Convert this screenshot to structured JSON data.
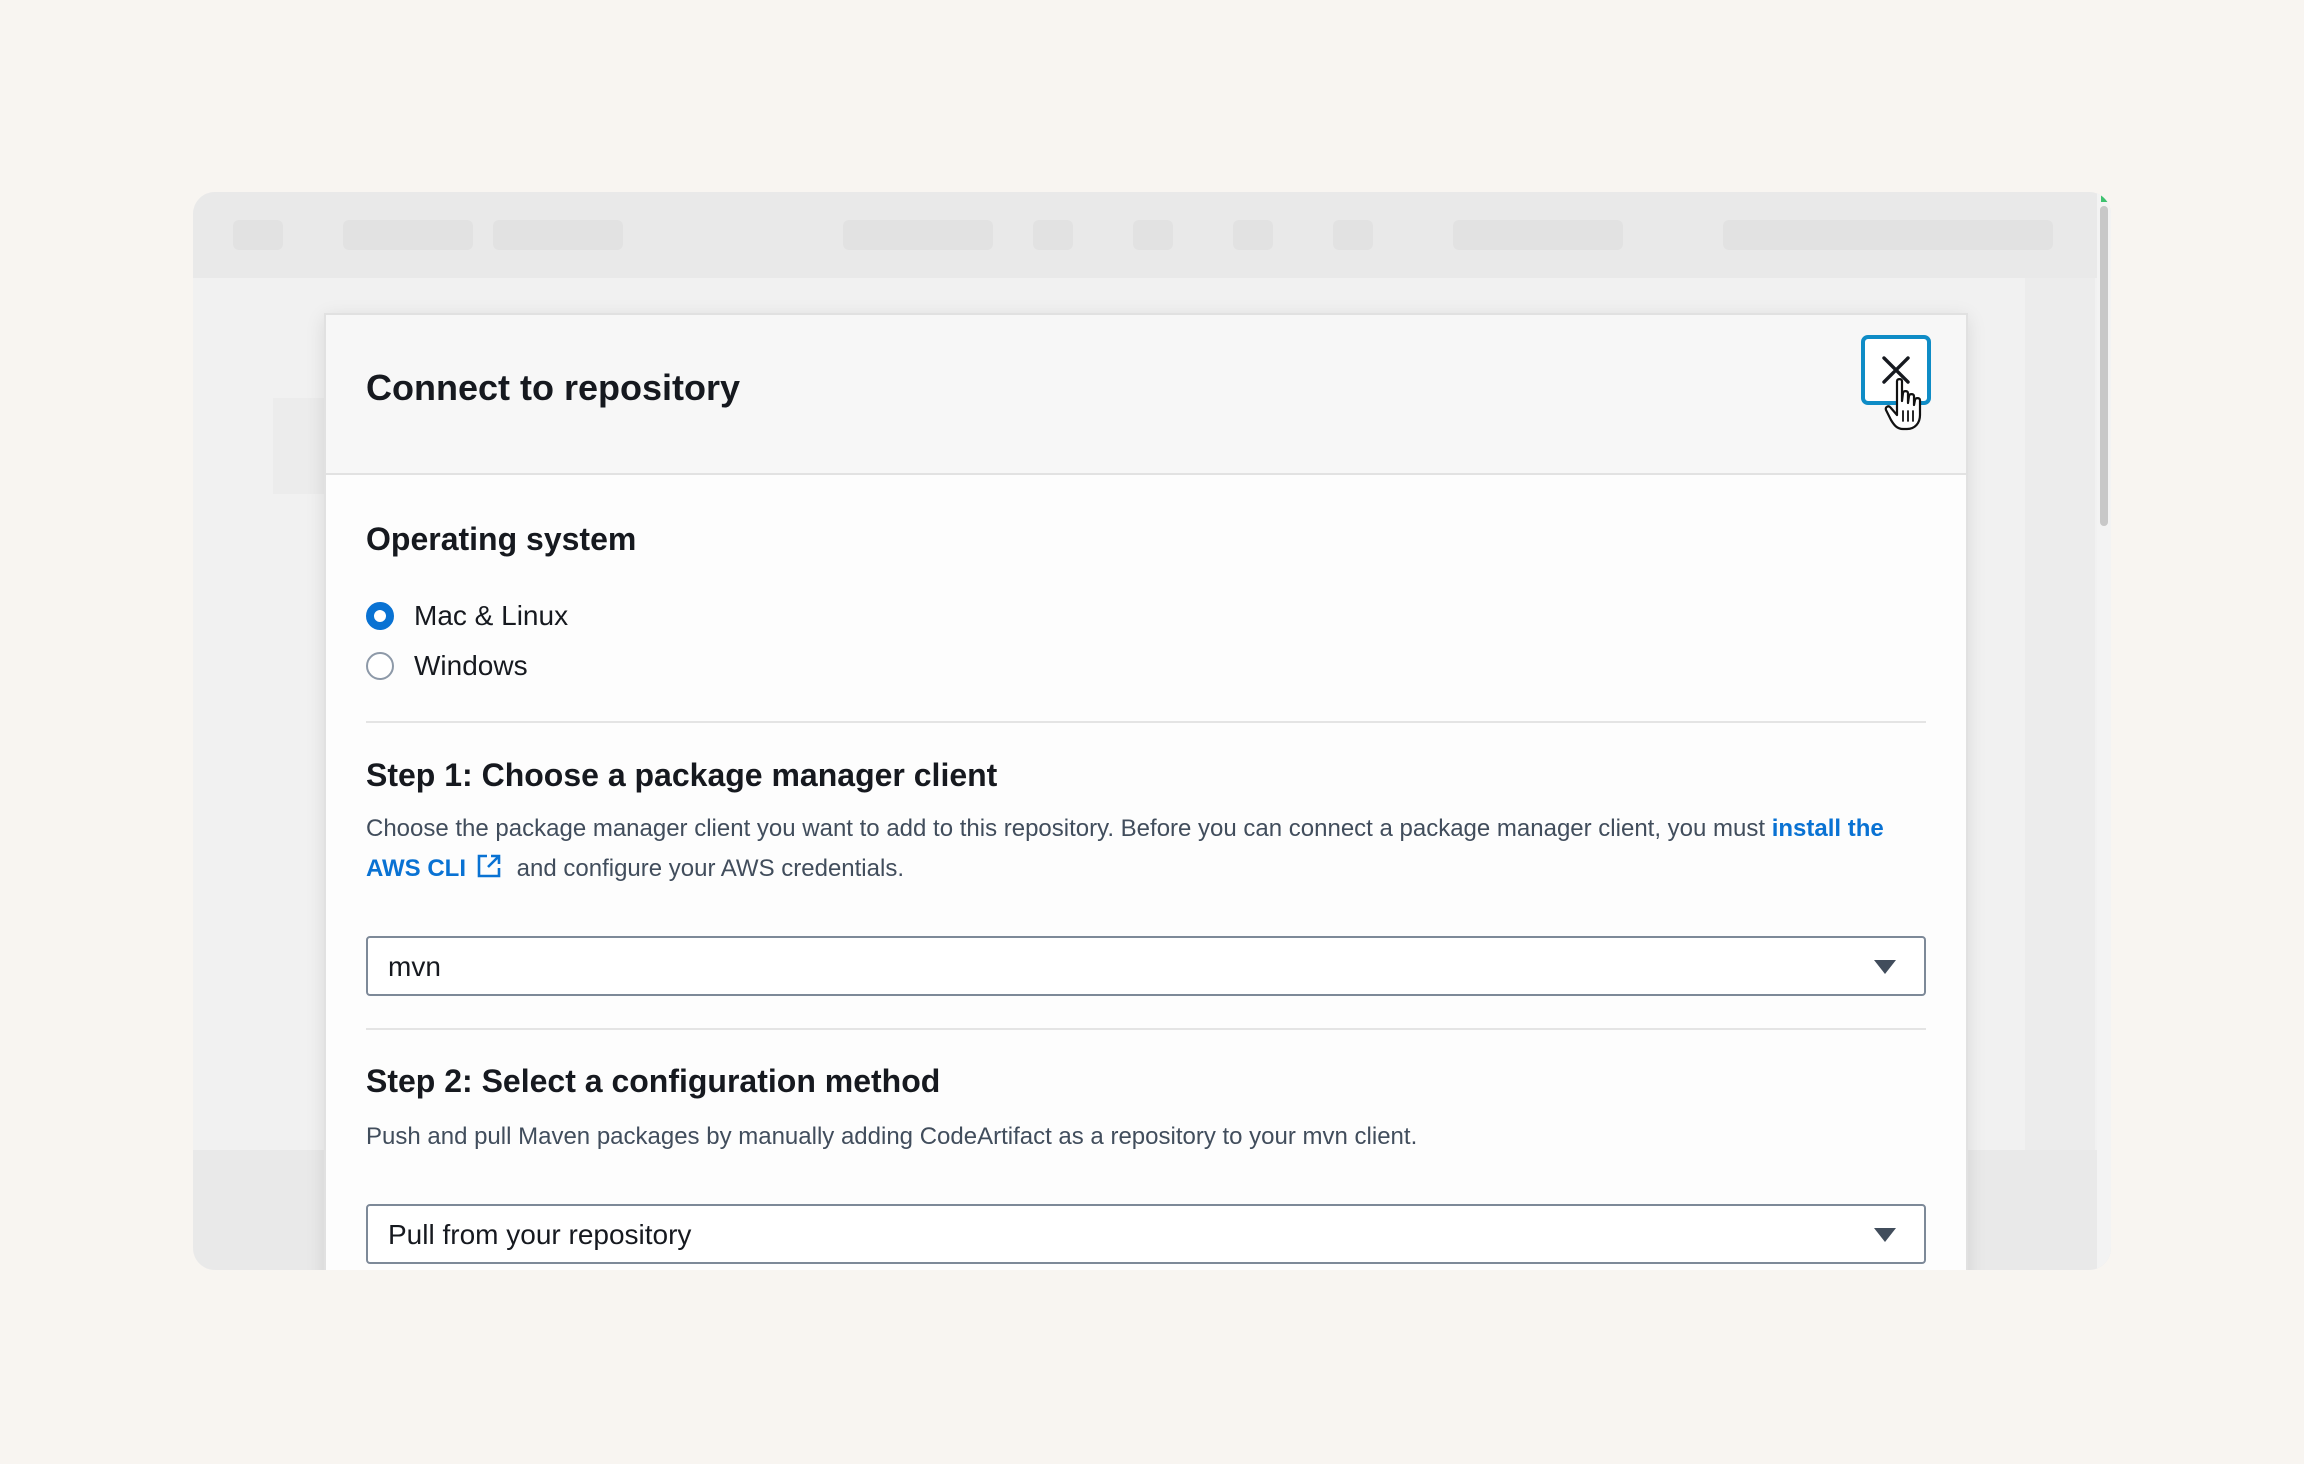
{
  "modal": {
    "title": "Connect to repository",
    "close_icon": "close-icon"
  },
  "os": {
    "heading": "Operating system",
    "options": [
      {
        "label": "Mac & Linux",
        "selected": true
      },
      {
        "label": "Windows",
        "selected": false
      }
    ]
  },
  "step1": {
    "heading": "Step 1: Choose a package manager client",
    "desc_before": "Choose the package manager client you want to add to this repository. Before you can connect a package manager client, you must ",
    "link_text": "install the AWS CLI",
    "link_icon": "external-link-icon",
    "desc_after": " and configure your AWS credentials.",
    "select_value": "mvn"
  },
  "step2": {
    "heading": "Step 2: Select a configuration method",
    "desc": "Push and pull Maven packages by manually adding CodeArtifact as a repository to your mvn client.",
    "select_value": "Pull from your repository"
  },
  "colors": {
    "accent": "#0972d3",
    "focus_ring": "#0f8cc6",
    "text": "#16191f",
    "muted_text": "#414d5c"
  }
}
